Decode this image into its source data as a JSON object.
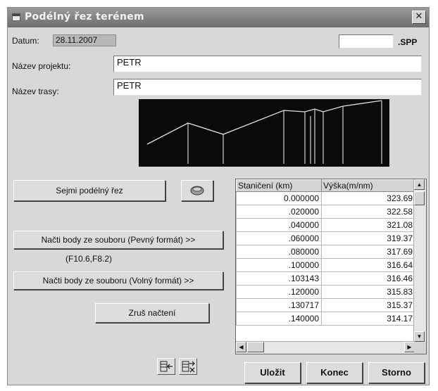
{
  "window": {
    "title": "Podélný řez terénem",
    "close_glyph": "✕"
  },
  "header": {
    "date_label": "Datum:",
    "date_value": "28.11.2007",
    "spp_value": "",
    "spp_suffix": ".SPP"
  },
  "form": {
    "project_label": "Název projektu:",
    "project_value": "PETR",
    "route_label": "Název trasy:",
    "route_value": "PETR"
  },
  "buttons": {
    "capture": "Sejmi podélný řez",
    "load_fixed": "Načti body ze souboru (Pevný formát) >>",
    "fixed_format_hint": "(F10.6,F8.2)",
    "load_free": "Načti body ze souboru  (Volný formát) >>",
    "cancel_load": "Zruš načtení",
    "save": "Uložit",
    "end": "Konec",
    "storno": "Storno"
  },
  "icons": {
    "capture": "database-icon",
    "insert_row": "insert-row-icon",
    "delete_row": "delete-row-icon",
    "close": "close-icon"
  },
  "grid": {
    "columns": [
      "Staničení (km)",
      "Výška(m/nm)"
    ],
    "rows": [
      [
        "0.000000",
        "323.69"
      ],
      [
        ".020000",
        "322.58"
      ],
      [
        ".040000",
        "321.08"
      ],
      [
        ".060000",
        "319.37"
      ],
      [
        ".080000",
        "317.69"
      ],
      [
        ".100000",
        "316.64"
      ],
      [
        ".103143",
        "316.46"
      ],
      [
        ".120000",
        "315.83"
      ],
      [
        ".130717",
        "315.37"
      ],
      [
        ".140000",
        "314.17"
      ]
    ]
  },
  "colors": {
    "profile_line": "#e0e0e0",
    "preview_bg": "#0a0a0a",
    "titlebar": "#7a7a7a"
  }
}
